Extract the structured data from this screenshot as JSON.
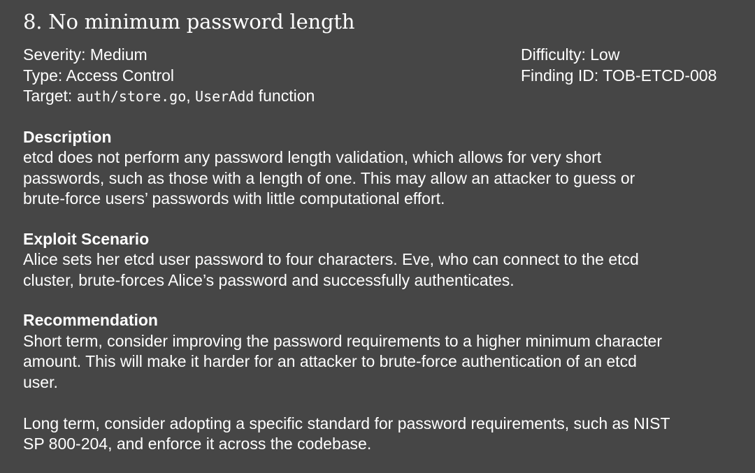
{
  "finding": {
    "title": "8. No minimum password length",
    "severity": "Severity: Medium",
    "type": "Type: Access Control",
    "target_prefix": "Target: ",
    "target_file": "auth/store.go",
    "target_sep": ", ",
    "target_func": "UserAdd",
    "target_suffix": " function",
    "difficulty": "Difficulty: Low",
    "finding_id": "Finding ID: TOB-ETCD-008"
  },
  "description": {
    "heading": "Description",
    "lines": [
      "etcd does not perform any password length validation, which allows for very short",
      "passwords, such as those with a length of one. This may allow an attacker to guess or",
      "brute-force users’ passwords with little computational effort."
    ]
  },
  "exploit": {
    "heading": "Exploit Scenario",
    "lines": [
      "Alice sets her etcd user password to four characters. Eve, who can connect to the etcd",
      "cluster, brute-forces Alice’s password and successfully authenticates."
    ]
  },
  "recommendation": {
    "heading": "Recommendation",
    "short_lines": [
      "Short term, consider improving the password requirements to a higher minimum character",
      "amount. This will make it harder for an attacker to brute-force authentication of an etcd",
      "user."
    ],
    "long_lines": [
      "Long term, consider adopting a specific standard for password requirements, such as NIST",
      "SP 800-204, and enforce it across the codebase."
    ]
  }
}
